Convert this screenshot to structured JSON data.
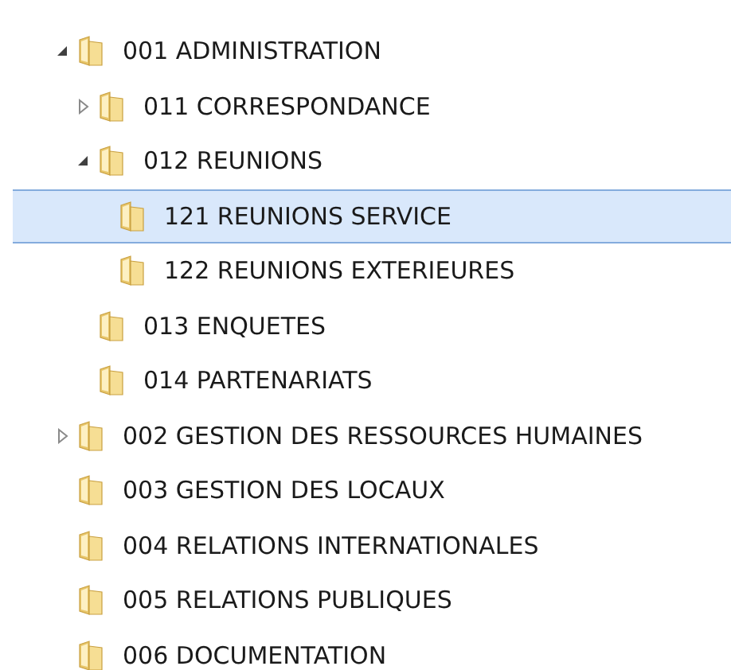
{
  "tree": [
    {
      "label": "001 ADMINISTRATION",
      "kind": "expanded",
      "selected": false,
      "children": [
        {
          "label": "011 CORRESPONDANCE",
          "kind": "collapsed",
          "selected": false
        },
        {
          "label": "012 REUNIONS",
          "kind": "expanded",
          "selected": false,
          "children": [
            {
              "label": "121 REUNIONS SERVICE",
              "selected": true
            },
            {
              "label": "122 REUNIONS EXTERIEURES",
              "selected": false
            }
          ]
        },
        {
          "label": "013 ENQUETES",
          "selected": false
        },
        {
          "label": "014 PARTENARIATS",
          "selected": false
        }
      ]
    },
    {
      "label": "002 GESTION DES RESSOURCES HUMAINES",
      "kind": "collapsed",
      "selected": false
    },
    {
      "label": "003 GESTION DES LOCAUX",
      "selected": false
    },
    {
      "label": "004 RELATIONS INTERNATIONALES",
      "selected": false
    },
    {
      "label": "005 RELATIONS PUBLIQUES",
      "selected": false
    },
    {
      "label": "006 DOCUMENTATION",
      "selected": false
    }
  ]
}
